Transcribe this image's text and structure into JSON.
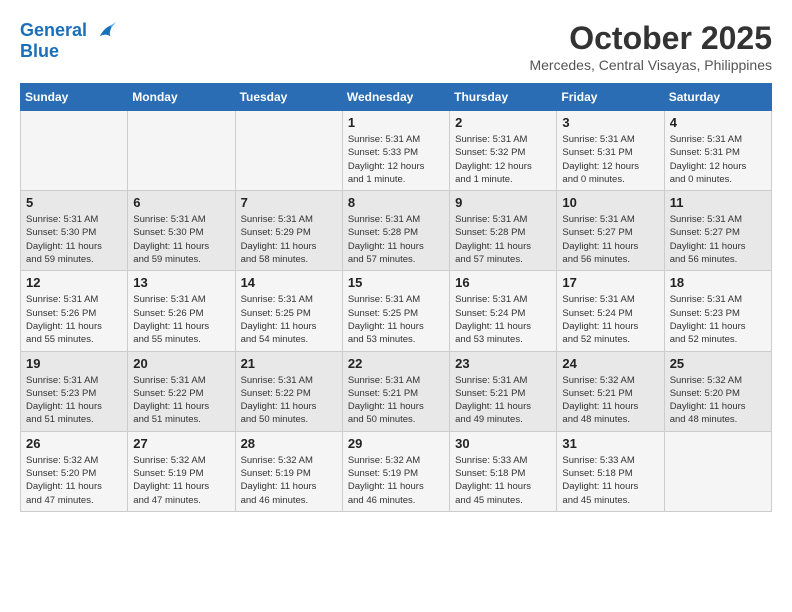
{
  "header": {
    "logo_line1": "General",
    "logo_line2": "Blue",
    "month": "October 2025",
    "location": "Mercedes, Central Visayas, Philippines"
  },
  "weekdays": [
    "Sunday",
    "Monday",
    "Tuesday",
    "Wednesday",
    "Thursday",
    "Friday",
    "Saturday"
  ],
  "weeks": [
    [
      {
        "day": "",
        "info": ""
      },
      {
        "day": "",
        "info": ""
      },
      {
        "day": "",
        "info": ""
      },
      {
        "day": "1",
        "info": "Sunrise: 5:31 AM\nSunset: 5:33 PM\nDaylight: 12 hours\nand 1 minute."
      },
      {
        "day": "2",
        "info": "Sunrise: 5:31 AM\nSunset: 5:32 PM\nDaylight: 12 hours\nand 1 minute."
      },
      {
        "day": "3",
        "info": "Sunrise: 5:31 AM\nSunset: 5:31 PM\nDaylight: 12 hours\nand 0 minutes."
      },
      {
        "day": "4",
        "info": "Sunrise: 5:31 AM\nSunset: 5:31 PM\nDaylight: 12 hours\nand 0 minutes."
      }
    ],
    [
      {
        "day": "5",
        "info": "Sunrise: 5:31 AM\nSunset: 5:30 PM\nDaylight: 11 hours\nand 59 minutes."
      },
      {
        "day": "6",
        "info": "Sunrise: 5:31 AM\nSunset: 5:30 PM\nDaylight: 11 hours\nand 59 minutes."
      },
      {
        "day": "7",
        "info": "Sunrise: 5:31 AM\nSunset: 5:29 PM\nDaylight: 11 hours\nand 58 minutes."
      },
      {
        "day": "8",
        "info": "Sunrise: 5:31 AM\nSunset: 5:28 PM\nDaylight: 11 hours\nand 57 minutes."
      },
      {
        "day": "9",
        "info": "Sunrise: 5:31 AM\nSunset: 5:28 PM\nDaylight: 11 hours\nand 57 minutes."
      },
      {
        "day": "10",
        "info": "Sunrise: 5:31 AM\nSunset: 5:27 PM\nDaylight: 11 hours\nand 56 minutes."
      },
      {
        "day": "11",
        "info": "Sunrise: 5:31 AM\nSunset: 5:27 PM\nDaylight: 11 hours\nand 56 minutes."
      }
    ],
    [
      {
        "day": "12",
        "info": "Sunrise: 5:31 AM\nSunset: 5:26 PM\nDaylight: 11 hours\nand 55 minutes."
      },
      {
        "day": "13",
        "info": "Sunrise: 5:31 AM\nSunset: 5:26 PM\nDaylight: 11 hours\nand 55 minutes."
      },
      {
        "day": "14",
        "info": "Sunrise: 5:31 AM\nSunset: 5:25 PM\nDaylight: 11 hours\nand 54 minutes."
      },
      {
        "day": "15",
        "info": "Sunrise: 5:31 AM\nSunset: 5:25 PM\nDaylight: 11 hours\nand 53 minutes."
      },
      {
        "day": "16",
        "info": "Sunrise: 5:31 AM\nSunset: 5:24 PM\nDaylight: 11 hours\nand 53 minutes."
      },
      {
        "day": "17",
        "info": "Sunrise: 5:31 AM\nSunset: 5:24 PM\nDaylight: 11 hours\nand 52 minutes."
      },
      {
        "day": "18",
        "info": "Sunrise: 5:31 AM\nSunset: 5:23 PM\nDaylight: 11 hours\nand 52 minutes."
      }
    ],
    [
      {
        "day": "19",
        "info": "Sunrise: 5:31 AM\nSunset: 5:23 PM\nDaylight: 11 hours\nand 51 minutes."
      },
      {
        "day": "20",
        "info": "Sunrise: 5:31 AM\nSunset: 5:22 PM\nDaylight: 11 hours\nand 51 minutes."
      },
      {
        "day": "21",
        "info": "Sunrise: 5:31 AM\nSunset: 5:22 PM\nDaylight: 11 hours\nand 50 minutes."
      },
      {
        "day": "22",
        "info": "Sunrise: 5:31 AM\nSunset: 5:21 PM\nDaylight: 11 hours\nand 50 minutes."
      },
      {
        "day": "23",
        "info": "Sunrise: 5:31 AM\nSunset: 5:21 PM\nDaylight: 11 hours\nand 49 minutes."
      },
      {
        "day": "24",
        "info": "Sunrise: 5:32 AM\nSunset: 5:21 PM\nDaylight: 11 hours\nand 48 minutes."
      },
      {
        "day": "25",
        "info": "Sunrise: 5:32 AM\nSunset: 5:20 PM\nDaylight: 11 hours\nand 48 minutes."
      }
    ],
    [
      {
        "day": "26",
        "info": "Sunrise: 5:32 AM\nSunset: 5:20 PM\nDaylight: 11 hours\nand 47 minutes."
      },
      {
        "day": "27",
        "info": "Sunrise: 5:32 AM\nSunset: 5:19 PM\nDaylight: 11 hours\nand 47 minutes."
      },
      {
        "day": "28",
        "info": "Sunrise: 5:32 AM\nSunset: 5:19 PM\nDaylight: 11 hours\nand 46 minutes."
      },
      {
        "day": "29",
        "info": "Sunrise: 5:32 AM\nSunset: 5:19 PM\nDaylight: 11 hours\nand 46 minutes."
      },
      {
        "day": "30",
        "info": "Sunrise: 5:33 AM\nSunset: 5:18 PM\nDaylight: 11 hours\nand 45 minutes."
      },
      {
        "day": "31",
        "info": "Sunrise: 5:33 AM\nSunset: 5:18 PM\nDaylight: 11 hours\nand 45 minutes."
      },
      {
        "day": "",
        "info": ""
      }
    ]
  ]
}
